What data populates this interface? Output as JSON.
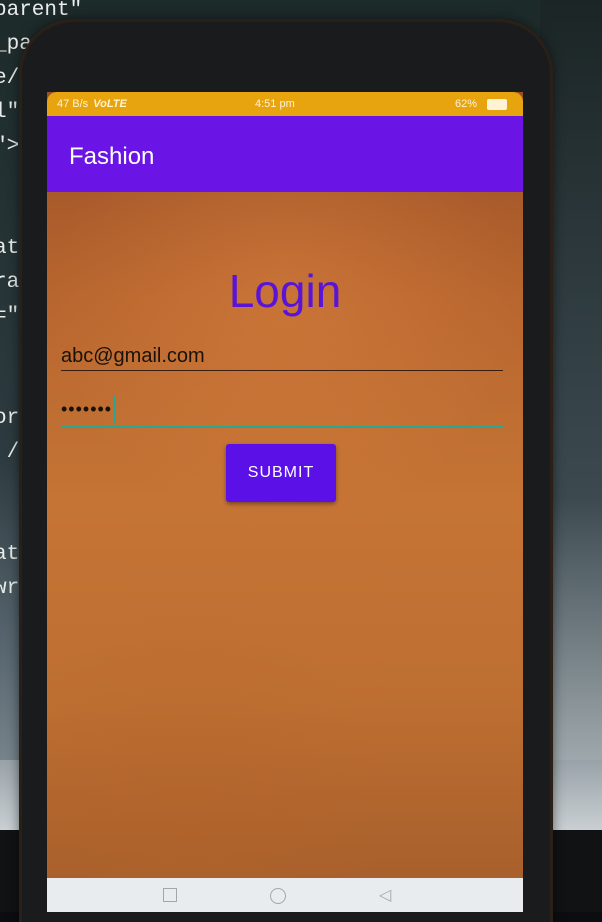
{
  "background_code": {
    "lines": [
      "parent\"",
      "_par",
      "e/",
      "l\"",
      "\">",
      "",
      "",
      "atc",
      "ra",
      "=\"",
      "",
      "",
      "or/",
      " />",
      "",
      "",
      "atc",
      "wra"
    ]
  },
  "status_bar": {
    "signal": "47 B/s",
    "network": "VoLTE",
    "time": "4:51 pm",
    "battery": "62%"
  },
  "app_bar": {
    "title": "Fashion"
  },
  "login": {
    "title": "Login",
    "email_value": "abc@gmail.com",
    "password_value": "•••••••",
    "submit_label": "SUBMIT"
  },
  "navigation_bar": {
    "back_glyph": "◁"
  },
  "colors": {
    "app_bar": "#6a14e6",
    "status_bar": "#e8a40e",
    "accent": "#2aa794",
    "button": "#5a10e6",
    "title_text": "#5a14d8"
  }
}
